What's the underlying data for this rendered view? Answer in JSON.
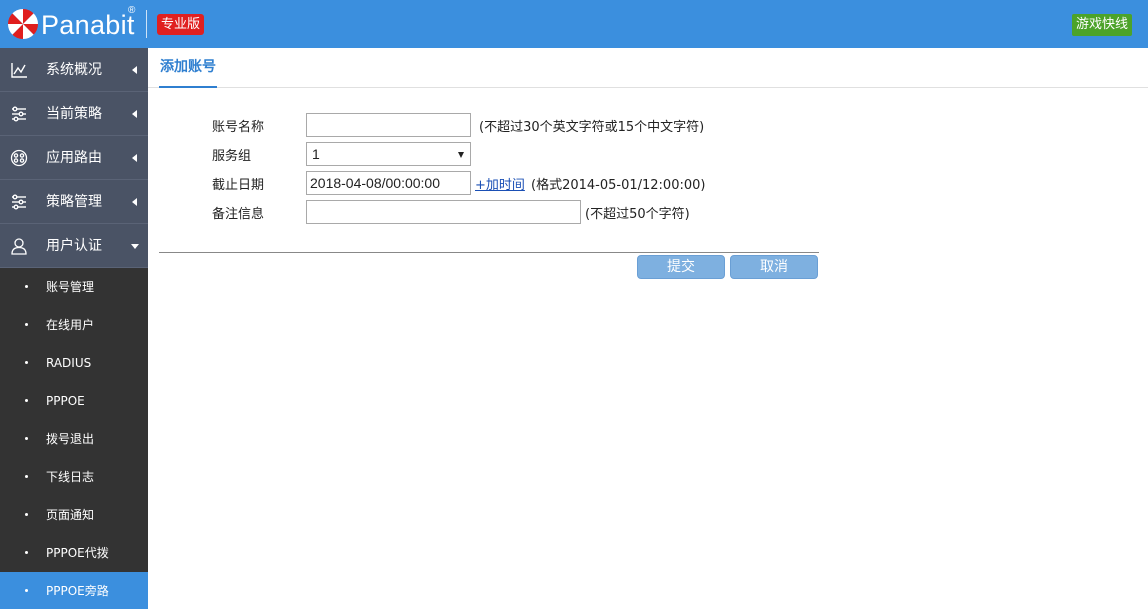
{
  "header": {
    "brand": "Panabit",
    "registered": "®",
    "edition": "专业版",
    "game_button": "游戏快线"
  },
  "sidebar": {
    "menu": [
      {
        "label": "系统概况",
        "icon": "chart-line-icon",
        "expanded": false
      },
      {
        "label": "当前策略",
        "icon": "sliders-icon",
        "expanded": false
      },
      {
        "label": "应用路由",
        "icon": "route-icon",
        "expanded": false
      },
      {
        "label": "策略管理",
        "icon": "sliders-icon",
        "expanded": false
      },
      {
        "label": "用户认证",
        "icon": "user-icon",
        "expanded": true
      }
    ],
    "submenu": [
      {
        "label": "账号管理"
      },
      {
        "label": "在线用户"
      },
      {
        "label": "RADIUS"
      },
      {
        "label": "PPPOE"
      },
      {
        "label": "拨号退出"
      },
      {
        "label": "下线日志"
      },
      {
        "label": "页面通知"
      },
      {
        "label": "PPPOE代拨"
      },
      {
        "label": "PPPOE旁路",
        "active": true
      }
    ]
  },
  "tab": {
    "label": "添加账号"
  },
  "form": {
    "account_name": {
      "label": "账号名称",
      "value": "",
      "hint": "(不超过30个英文字符或15个中文字符)"
    },
    "service_group": {
      "label": "服务组",
      "value": "1"
    },
    "expiry_date": {
      "label": "截止日期",
      "value": "2018-04-08/00:00:00",
      "add_time": "+加时间",
      "hint": "(格式2014-05-01/12:00:00)"
    },
    "remark": {
      "label": "备注信息",
      "value": "",
      "hint": "(不超过50个字符)"
    }
  },
  "buttons": {
    "submit": "提交",
    "cancel": "取消"
  },
  "colors": {
    "topbar": "#3b8fde",
    "sidebar_menu": "#4a5365",
    "sidebar_sub": "#333333",
    "edition_badge": "#e02020",
    "game_button": "#4ca32a",
    "button": "#7eb0e0"
  }
}
